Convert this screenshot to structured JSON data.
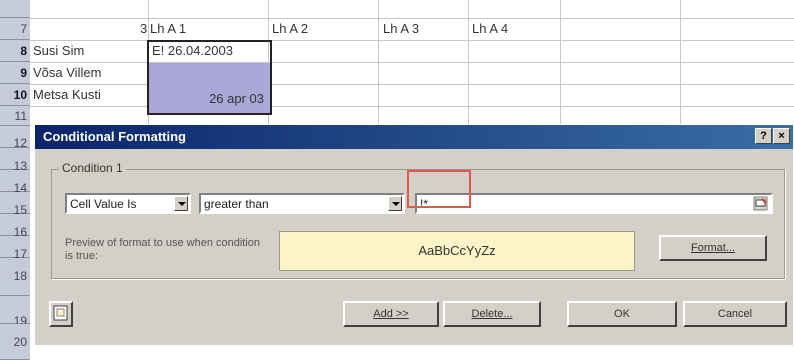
{
  "sheet": {
    "rows": [
      "7",
      "8",
      "9",
      "10",
      "11",
      "12",
      "13",
      "14",
      "15",
      "16",
      "17",
      "18",
      "19",
      "20"
    ],
    "header_row": {
      "num": "3",
      "cols": [
        "Lh A 1",
        "Lh A 2",
        "Lh A 3",
        "Lh A 4"
      ]
    },
    "names": [
      "Susi Sim",
      "Võsa Villem",
      "Metsa Kusti"
    ],
    "cell_b8": "E! 26.04.2003",
    "cell_b10": "26 apr 03"
  },
  "dialog": {
    "title": "Conditional Formatting",
    "help_btn": "?",
    "close_btn": "×",
    "condition_label": "Condition 1",
    "cell_value_combo": "Cell Value Is",
    "operator_combo": "greater than",
    "value_field": "!*",
    "preview_label": "Preview of format to use when condition is true:",
    "preview_text": "AaBbCcYyZz",
    "format_button": "Format...",
    "add_button": "Add >>",
    "delete_button": "Delete...",
    "ok_button": "OK",
    "cancel_button": "Cancel"
  },
  "colors": {
    "title_bar": "#0a246a",
    "selection_fill": "#a9a8d6",
    "preview_bg": "#fbf4c8",
    "highlight_box": "#e05a4a"
  }
}
